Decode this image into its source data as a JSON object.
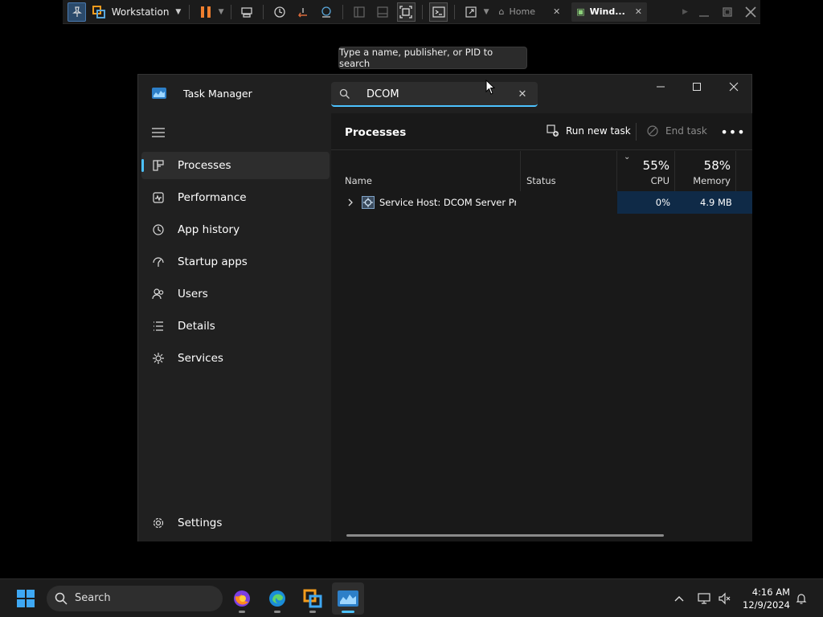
{
  "vm_toolbar": {
    "vm_name": "Workstation",
    "tabs": [
      {
        "label": "Home"
      },
      {
        "label": "Wind..."
      }
    ]
  },
  "tooltip": "Type a name, publisher, or PID to search",
  "window": {
    "title": "Task Manager",
    "search": {
      "value": "DCOM",
      "placeholder": "Type a name, publisher, or PID to search"
    }
  },
  "sidebar": {
    "items": [
      {
        "label": "Processes",
        "icon": "processes-icon",
        "active": true
      },
      {
        "label": "Performance",
        "icon": "performance-icon"
      },
      {
        "label": "App history",
        "icon": "app-history-icon"
      },
      {
        "label": "Startup apps",
        "icon": "startup-apps-icon"
      },
      {
        "label": "Users",
        "icon": "users-icon"
      },
      {
        "label": "Details",
        "icon": "details-icon"
      },
      {
        "label": "Services",
        "icon": "services-icon"
      }
    ],
    "settings": "Settings"
  },
  "main": {
    "title": "Processes",
    "run_new_task": "Run new task",
    "end_task": "End task",
    "columns": {
      "name": "Name",
      "status": "Status",
      "cpu_pct": "55%",
      "cpu_label": "CPU",
      "mem_pct": "58%",
      "mem_label": "Memory"
    },
    "rows": [
      {
        "name": "Service Host: DCOM Server Pr...",
        "status": "",
        "cpu": "0%",
        "memory": "4.9 MB"
      }
    ]
  },
  "taskbar": {
    "search_label": "Search",
    "time": "4:16 AM",
    "date": "12/9/2024"
  },
  "colors": {
    "accent": "#4cc2ff",
    "highlight_cell": "#0f2a47"
  }
}
